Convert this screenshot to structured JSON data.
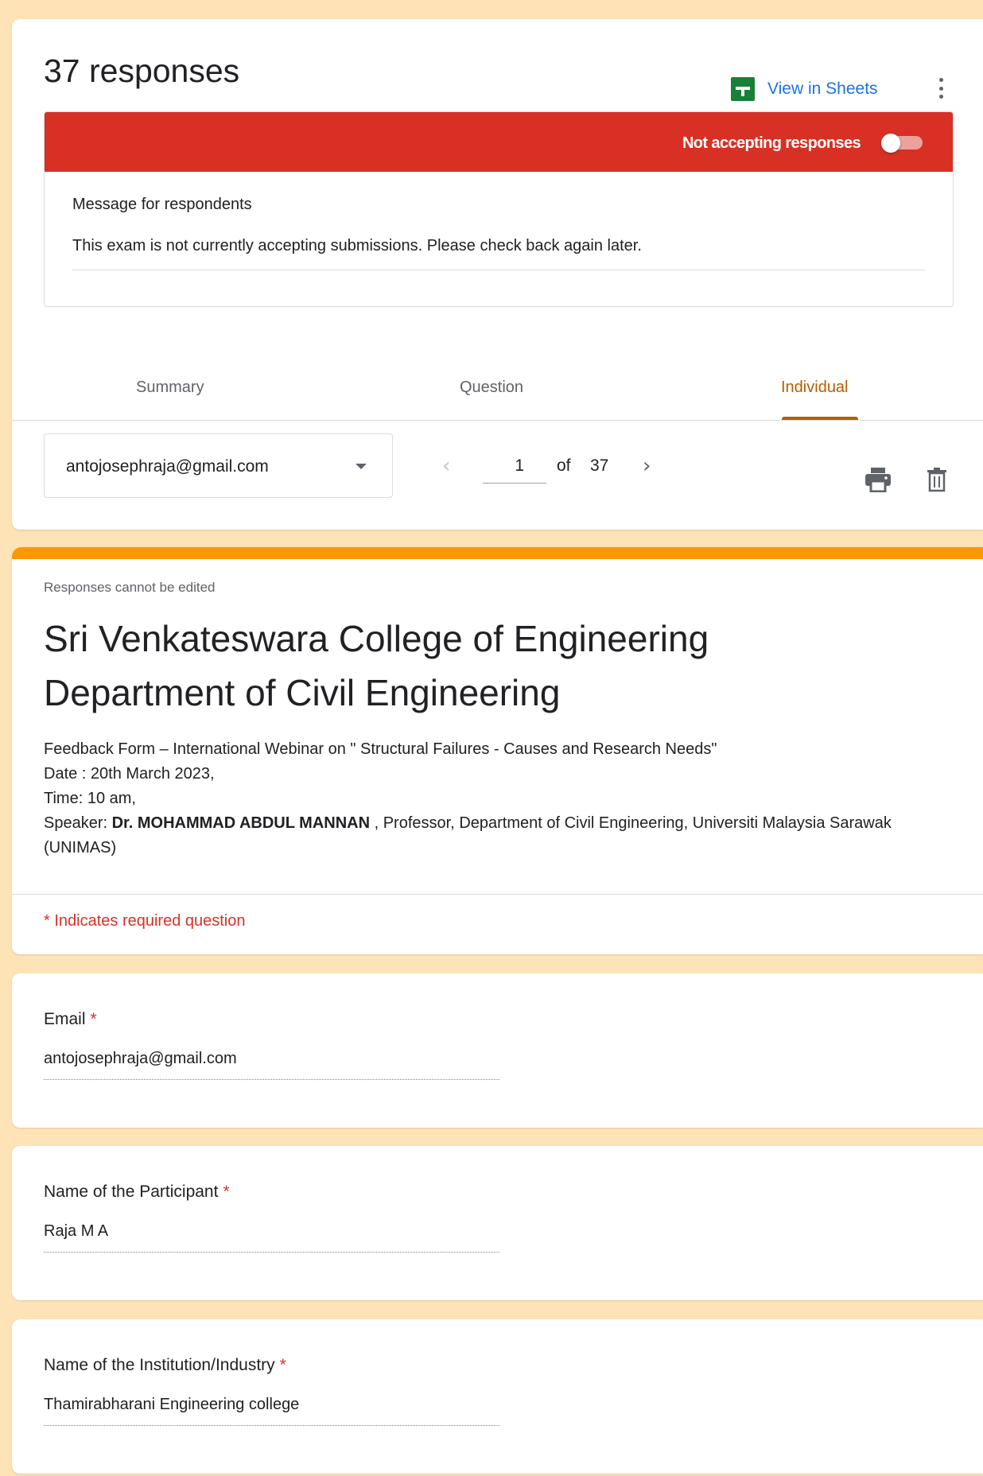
{
  "header": {
    "responses_title": "37 responses",
    "view_in_sheets": "View in Sheets"
  },
  "banner": {
    "status_text": "Not accepting responses",
    "accepting": false,
    "color": "#d93025"
  },
  "message": {
    "label": "Message for respondents",
    "value": "This exam is not currently accepting submissions. Please check back again later."
  },
  "tabs": [
    {
      "label": "Summary",
      "active": false
    },
    {
      "label": "Question",
      "active": false
    },
    {
      "label": "Individual",
      "active": true
    }
  ],
  "respondent": {
    "selected_email": "antojosephraja@gmail.com"
  },
  "pager": {
    "current": "1",
    "of_label": "of",
    "total": "37"
  },
  "form": {
    "notice": "Responses cannot be edited",
    "title_line1": "Sri Venkateswara College of Engineering",
    "title_line2": "Department of Civil Engineering",
    "desc_line1": "Feedback Form – International Webinar on \" Structural Failures - Causes and Research Needs\"",
    "desc_line2": "Date : 20th March 2023,",
    "desc_line3": "Time: 10 am,",
    "desc_speaker_prefix": "Speaker:  ",
    "desc_speaker_name": "Dr. MOHAMMAD ABDUL MANNAN",
    "desc_speaker_rest": " , Professor, Department of Civil Engineering, Universiti Malaysia Sarawak (UNIMAS)",
    "required_note": "* Indicates required question",
    "accent_color": "#ff9800"
  },
  "questions": [
    {
      "label": "Email",
      "required_mark": "*",
      "answer": "antojosephraja@gmail.com"
    },
    {
      "label": "Name of the Participant",
      "required_mark": "*",
      "answer": "Raja M A"
    },
    {
      "label": "Name of the Institution/Industry",
      "required_mark": "*",
      "answer": "Thamirabharani Engineering college"
    }
  ],
  "icons": {
    "sheets": "google-sheets-icon",
    "more": "more-vert-icon",
    "dropdown": "arrow-drop-down-icon",
    "prev": "chevron-left-icon",
    "next": "chevron-right-icon",
    "print": "print-icon",
    "delete": "trash-icon"
  }
}
